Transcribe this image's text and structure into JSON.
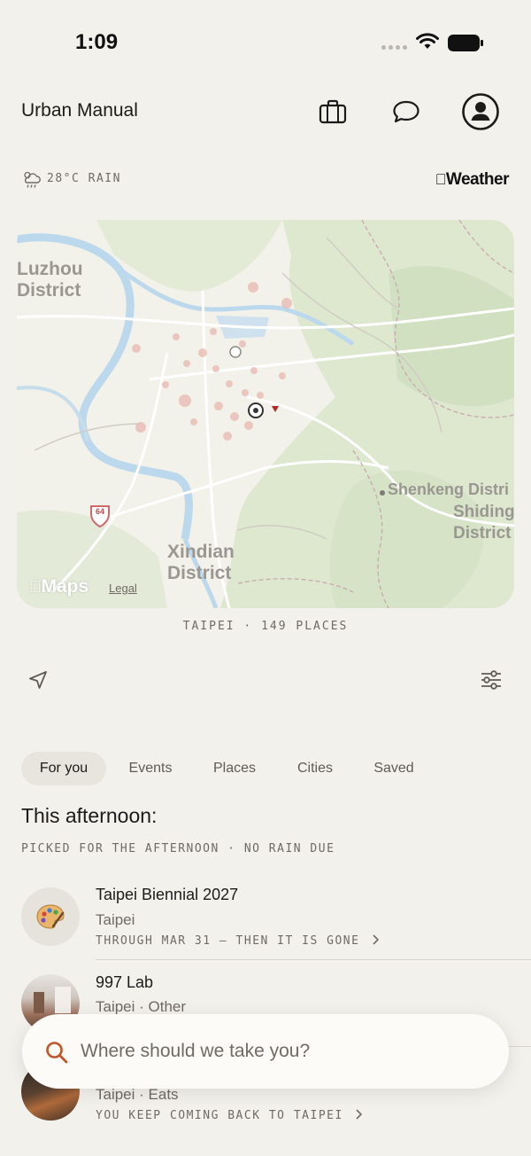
{
  "status_bar": {
    "time": "1:09"
  },
  "header": {
    "title": "Urban Manual"
  },
  "weather": {
    "text": "28°C RAIN",
    "brand": "Weather"
  },
  "map": {
    "labels": {
      "luzhou": "Luzhou\nDistrict",
      "xindian": "Xindian\nDistrict",
      "shenkeng": "Shenkeng Distri",
      "shiding": "Shiding\nDistrict",
      "route": "64"
    },
    "attribution": {
      "maps": "Maps",
      "legal": "Legal"
    },
    "caption": "TAIPEI · 149 PLACES"
  },
  "tabs": [
    {
      "label": "For you",
      "active": true
    },
    {
      "label": "Events"
    },
    {
      "label": "Places"
    },
    {
      "label": "Cities"
    },
    {
      "label": "Saved"
    }
  ],
  "section": {
    "title": "This afternoon:",
    "subtitle": "PICKED FOR THE AFTERNOON · NO RAIN DUE"
  },
  "items": [
    {
      "title": "Taipei Biennial 2027",
      "meta": "Taipei",
      "cta": "THROUGH MAR 31 — THEN IT IS GONE",
      "icon": "palette-icon"
    },
    {
      "title": "997 Lab",
      "meta": "Taipei · Other"
    },
    {
      "meta": "Taipei · Eats",
      "cta": "YOU KEEP COMING BACK TO TAIPEI"
    }
  ],
  "search": {
    "placeholder": "Where should we take you?"
  },
  "colors": {
    "accent": "#c2562a",
    "background": "#f3f1ec",
    "search_bg": "#fdfbf7"
  }
}
